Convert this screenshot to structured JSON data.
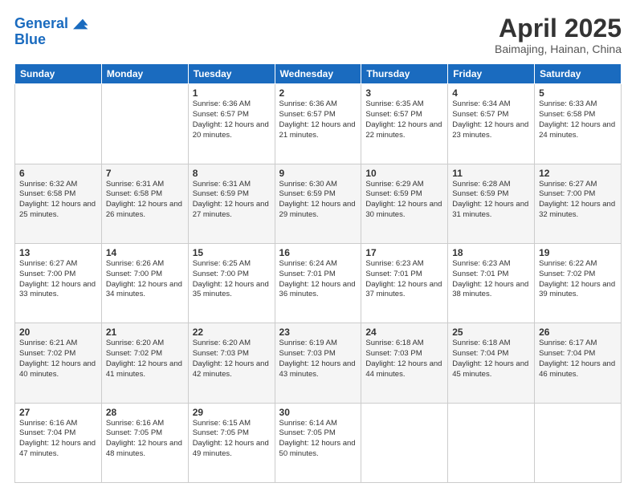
{
  "header": {
    "logo_line1": "General",
    "logo_line2": "Blue",
    "title": "April 2025",
    "subtitle": "Baimajing, Hainan, China"
  },
  "calendar": {
    "days_of_week": [
      "Sunday",
      "Monday",
      "Tuesday",
      "Wednesday",
      "Thursday",
      "Friday",
      "Saturday"
    ],
    "weeks": [
      [
        {
          "day": "",
          "info": ""
        },
        {
          "day": "",
          "info": ""
        },
        {
          "day": "1",
          "info": "Sunrise: 6:36 AM\nSunset: 6:57 PM\nDaylight: 12 hours and 20 minutes."
        },
        {
          "day": "2",
          "info": "Sunrise: 6:36 AM\nSunset: 6:57 PM\nDaylight: 12 hours and 21 minutes."
        },
        {
          "day": "3",
          "info": "Sunrise: 6:35 AM\nSunset: 6:57 PM\nDaylight: 12 hours and 22 minutes."
        },
        {
          "day": "4",
          "info": "Sunrise: 6:34 AM\nSunset: 6:57 PM\nDaylight: 12 hours and 23 minutes."
        },
        {
          "day": "5",
          "info": "Sunrise: 6:33 AM\nSunset: 6:58 PM\nDaylight: 12 hours and 24 minutes."
        }
      ],
      [
        {
          "day": "6",
          "info": "Sunrise: 6:32 AM\nSunset: 6:58 PM\nDaylight: 12 hours and 25 minutes."
        },
        {
          "day": "7",
          "info": "Sunrise: 6:31 AM\nSunset: 6:58 PM\nDaylight: 12 hours and 26 minutes."
        },
        {
          "day": "8",
          "info": "Sunrise: 6:31 AM\nSunset: 6:59 PM\nDaylight: 12 hours and 27 minutes."
        },
        {
          "day": "9",
          "info": "Sunrise: 6:30 AM\nSunset: 6:59 PM\nDaylight: 12 hours and 29 minutes."
        },
        {
          "day": "10",
          "info": "Sunrise: 6:29 AM\nSunset: 6:59 PM\nDaylight: 12 hours and 30 minutes."
        },
        {
          "day": "11",
          "info": "Sunrise: 6:28 AM\nSunset: 6:59 PM\nDaylight: 12 hours and 31 minutes."
        },
        {
          "day": "12",
          "info": "Sunrise: 6:27 AM\nSunset: 7:00 PM\nDaylight: 12 hours and 32 minutes."
        }
      ],
      [
        {
          "day": "13",
          "info": "Sunrise: 6:27 AM\nSunset: 7:00 PM\nDaylight: 12 hours and 33 minutes."
        },
        {
          "day": "14",
          "info": "Sunrise: 6:26 AM\nSunset: 7:00 PM\nDaylight: 12 hours and 34 minutes."
        },
        {
          "day": "15",
          "info": "Sunrise: 6:25 AM\nSunset: 7:00 PM\nDaylight: 12 hours and 35 minutes."
        },
        {
          "day": "16",
          "info": "Sunrise: 6:24 AM\nSunset: 7:01 PM\nDaylight: 12 hours and 36 minutes."
        },
        {
          "day": "17",
          "info": "Sunrise: 6:23 AM\nSunset: 7:01 PM\nDaylight: 12 hours and 37 minutes."
        },
        {
          "day": "18",
          "info": "Sunrise: 6:23 AM\nSunset: 7:01 PM\nDaylight: 12 hours and 38 minutes."
        },
        {
          "day": "19",
          "info": "Sunrise: 6:22 AM\nSunset: 7:02 PM\nDaylight: 12 hours and 39 minutes."
        }
      ],
      [
        {
          "day": "20",
          "info": "Sunrise: 6:21 AM\nSunset: 7:02 PM\nDaylight: 12 hours and 40 minutes."
        },
        {
          "day": "21",
          "info": "Sunrise: 6:20 AM\nSunset: 7:02 PM\nDaylight: 12 hours and 41 minutes."
        },
        {
          "day": "22",
          "info": "Sunrise: 6:20 AM\nSunset: 7:03 PM\nDaylight: 12 hours and 42 minutes."
        },
        {
          "day": "23",
          "info": "Sunrise: 6:19 AM\nSunset: 7:03 PM\nDaylight: 12 hours and 43 minutes."
        },
        {
          "day": "24",
          "info": "Sunrise: 6:18 AM\nSunset: 7:03 PM\nDaylight: 12 hours and 44 minutes."
        },
        {
          "day": "25",
          "info": "Sunrise: 6:18 AM\nSunset: 7:04 PM\nDaylight: 12 hours and 45 minutes."
        },
        {
          "day": "26",
          "info": "Sunrise: 6:17 AM\nSunset: 7:04 PM\nDaylight: 12 hours and 46 minutes."
        }
      ],
      [
        {
          "day": "27",
          "info": "Sunrise: 6:16 AM\nSunset: 7:04 PM\nDaylight: 12 hours and 47 minutes."
        },
        {
          "day": "28",
          "info": "Sunrise: 6:16 AM\nSunset: 7:05 PM\nDaylight: 12 hours and 48 minutes."
        },
        {
          "day": "29",
          "info": "Sunrise: 6:15 AM\nSunset: 7:05 PM\nDaylight: 12 hours and 49 minutes."
        },
        {
          "day": "30",
          "info": "Sunrise: 6:14 AM\nSunset: 7:05 PM\nDaylight: 12 hours and 50 minutes."
        },
        {
          "day": "",
          "info": ""
        },
        {
          "day": "",
          "info": ""
        },
        {
          "day": "",
          "info": ""
        }
      ]
    ]
  }
}
